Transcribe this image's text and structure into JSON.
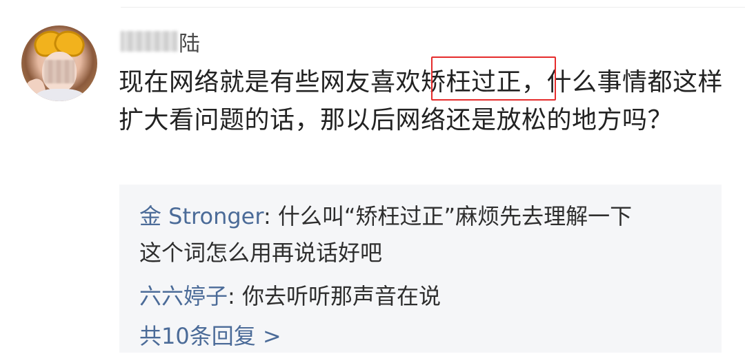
{
  "comment": {
    "username_visible": "陆",
    "text_before": "现在网络就是有些网友喜欢",
    "text_highlight": "矫枉过正",
    "text_after": "，什么事情都这样扩大看问题的话，那以后网络还是放松的地方吗？"
  },
  "replies": [
    {
      "name": "金 Stronger",
      "sep": ": ",
      "text_line1": "什么叫“矫枉过正”麻烦先去理解一下",
      "text_line2": "这个词怎么用再说话好吧"
    },
    {
      "name": "六六婷子",
      "sep": ": ",
      "text_line1": "你去听听那声音在说"
    }
  ],
  "more_replies_label": "共10条回复 >",
  "colors": {
    "link": "#4b6b98",
    "highlight_border": "#e52b2b",
    "reply_bg": "#f5f6f8"
  }
}
